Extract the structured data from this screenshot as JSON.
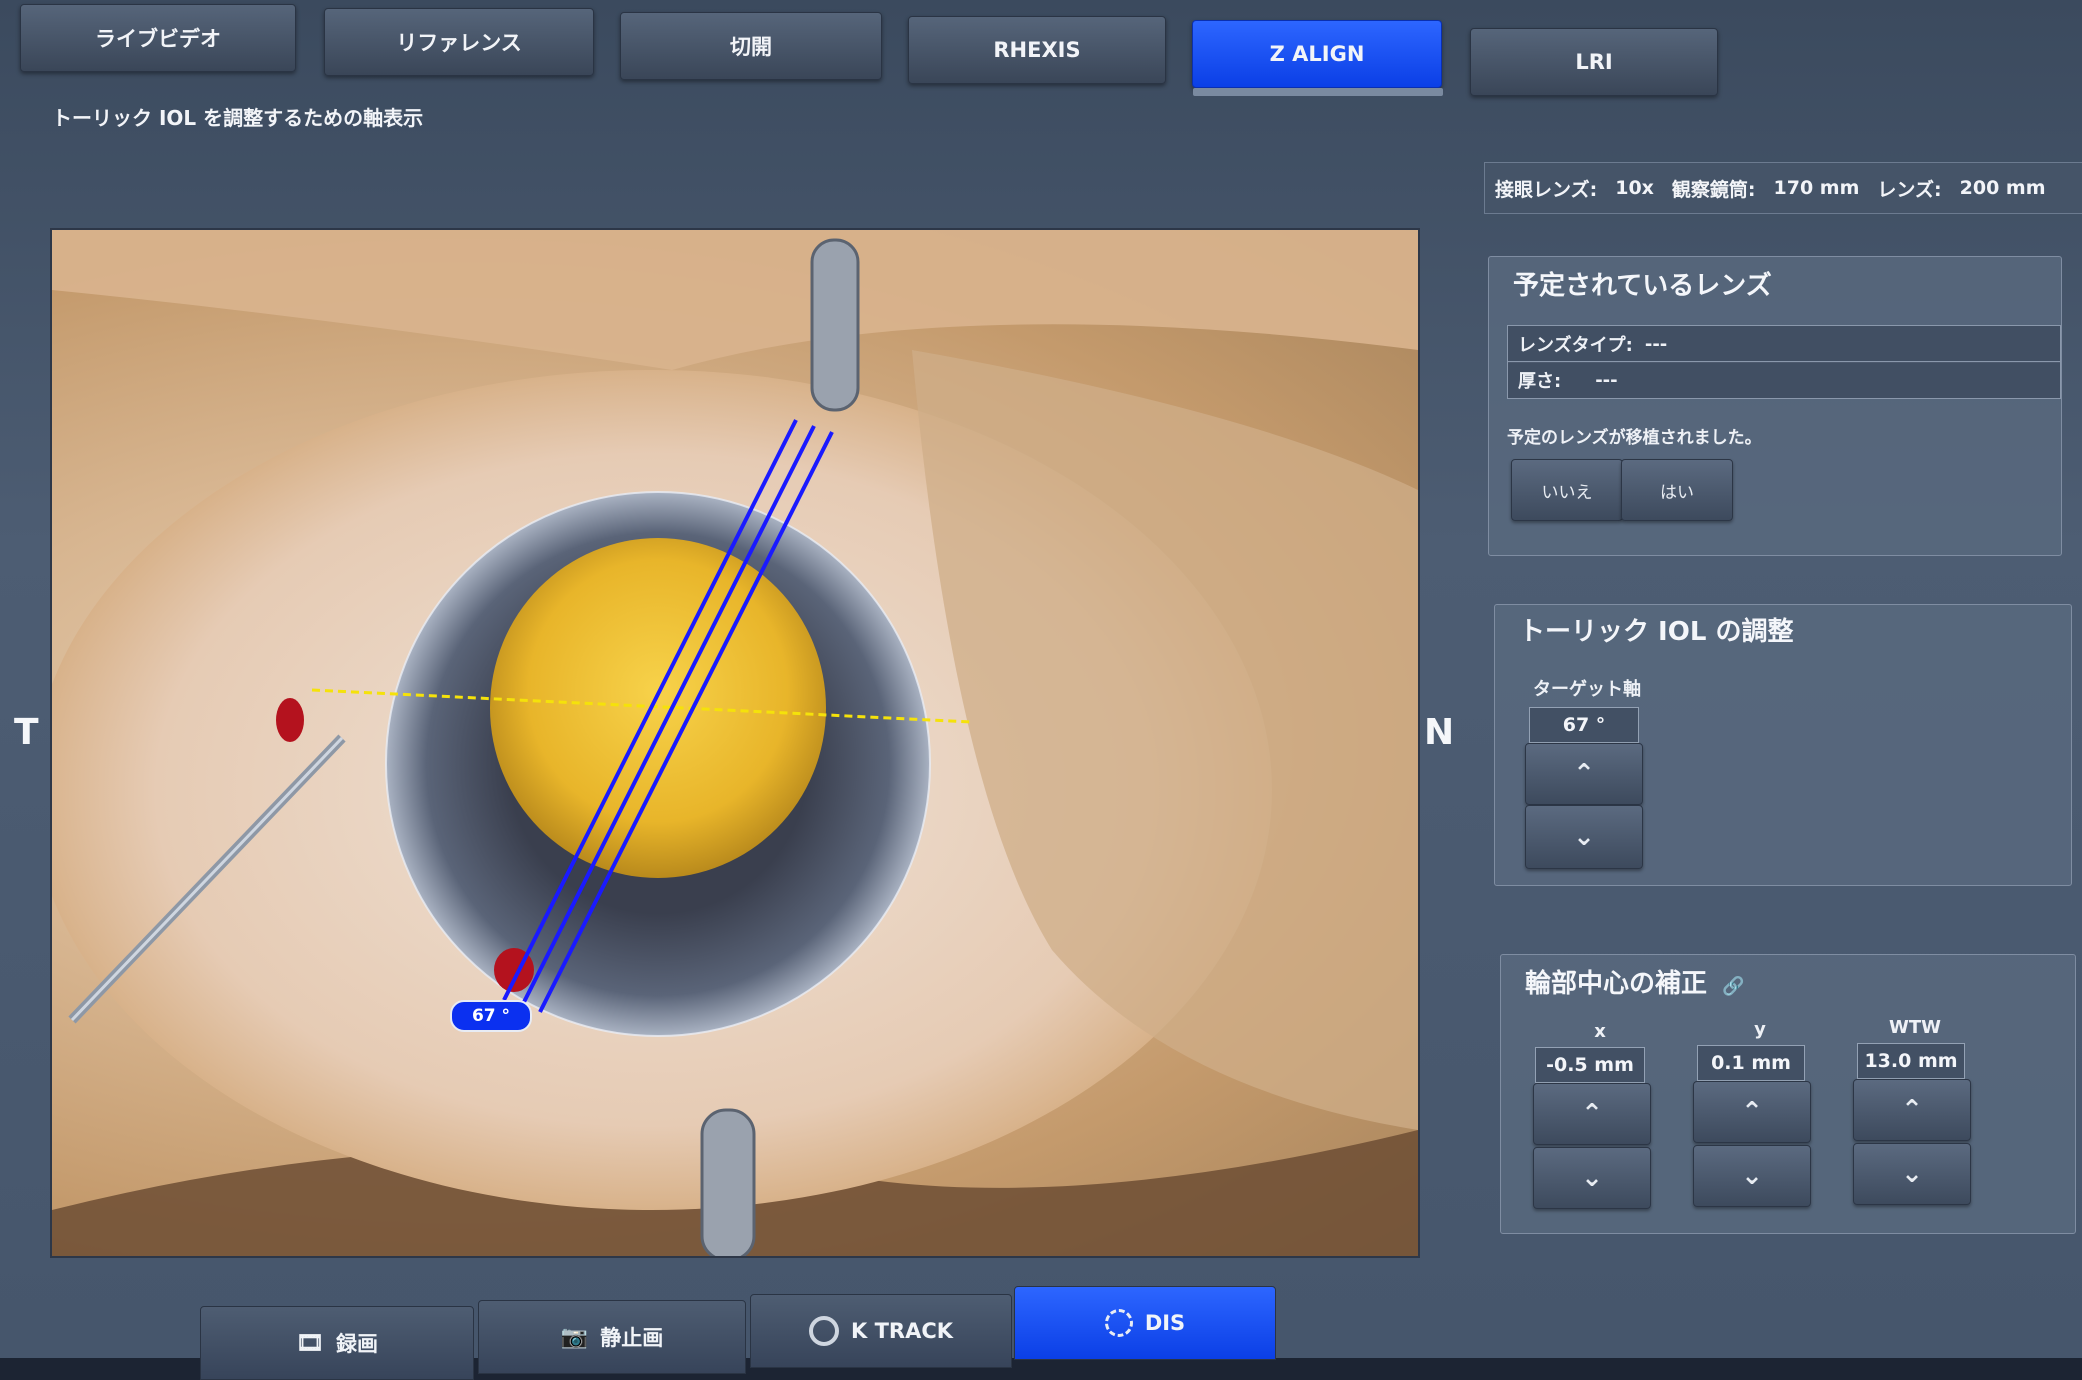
{
  "tabs": [
    {
      "label": "ライブビデオ"
    },
    {
      "label": "リファレンス"
    },
    {
      "label": "切開"
    },
    {
      "label": "RHEXIS"
    },
    {
      "label": "Z ALIGN",
      "active": true
    },
    {
      "label": "LRI"
    }
  ],
  "page_title": "トーリック IOL を調整するための軸表示",
  "info": {
    "eyepiece_label": "接眼レンズ:",
    "eyepiece_value": "10x",
    "tube_label": "観察鏡筒:",
    "tube_value": "170 mm",
    "lens_label": "レンズ:",
    "lens_value": "200 mm"
  },
  "video": {
    "left_marker": "T",
    "right_marker": "N",
    "axis_angle_label": "67 °"
  },
  "planned_lens": {
    "title": "予定されているレンズ",
    "type_label": "レンズタイプ:",
    "type_value": "---",
    "thickness_label": "厚さ:",
    "thickness_value": "---",
    "implanted_question": "予定のレンズが移植されました。",
    "no_label": "いいえ",
    "yes_label": "はい"
  },
  "toric": {
    "title": "トーリック IOL の調整",
    "target_axis_label": "ターゲット軸",
    "target_axis_value": "67 °"
  },
  "limbus": {
    "title": "輪部中心の補正",
    "x_label": "x",
    "x_value": "-0.5 mm",
    "y_label": "y",
    "y_value": "0.1 mm",
    "wtw_label": "WTW",
    "wtw_value": "13.0 mm"
  },
  "bottom": {
    "record_label": "録画",
    "still_label": "静止画",
    "ktrack_label": "K TRACK",
    "dis_label": "DIS"
  },
  "colors": {
    "accent_blue": "#0b3fe6",
    "axis_line": "#1a1aff",
    "ref_line": "#f5e20a"
  }
}
